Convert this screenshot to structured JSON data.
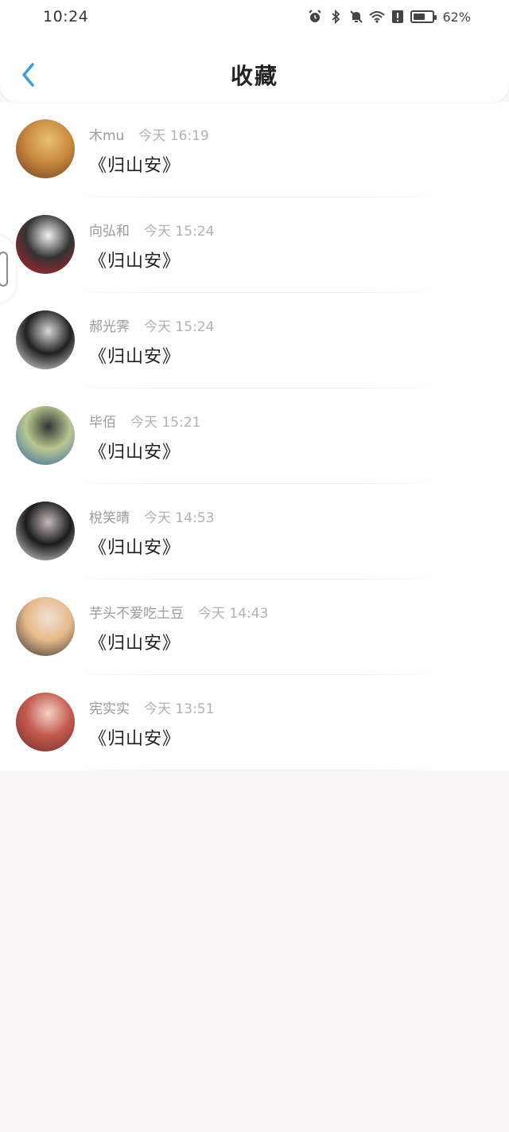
{
  "status_bar": {
    "time": "10:24",
    "battery_percent": "62%",
    "battery_level": 0.62,
    "icons": [
      "alarm-icon",
      "bluetooth-icon",
      "mute-icon",
      "wifi-icon",
      "alert-icon",
      "battery-icon"
    ]
  },
  "header": {
    "title": "收藏",
    "back_icon": "chevron-left-icon",
    "accent": "#3b9be6"
  },
  "favorites": [
    {
      "author": "木mu",
      "time": "今天 16:19",
      "title": "《归山安》",
      "avatar_colors": [
        "#6b3b20",
        "#c98a3f",
        "#e8c070"
      ]
    },
    {
      "author": "向弘和",
      "time": "今天 15:24",
      "title": "《归山安》",
      "avatar_colors": [
        "#c8202a",
        "#333333",
        "#f2f2f2"
      ]
    },
    {
      "author": "郝光霁",
      "time": "今天 15:24",
      "title": "《归山安》",
      "avatar_colors": [
        "#f4f4f4",
        "#202020",
        "#d8d8d8"
      ]
    },
    {
      "author": "毕佰",
      "time": "今天 15:21",
      "title": "《归山安》",
      "avatar_colors": [
        "#2a5fa8",
        "#b8c890",
        "#333333"
      ]
    },
    {
      "author": "梲笑晴",
      "time": "今天 14:53",
      "title": "《归山安》",
      "avatar_colors": [
        "#efe9ea",
        "#1b1b1b",
        "#c5b8ba"
      ]
    },
    {
      "author": "芋头不爱吃土豆",
      "time": "今天 14:43",
      "title": "《归山安》",
      "avatar_colors": [
        "#2e2e2e",
        "#e7b98a",
        "#f1e2d6"
      ]
    },
    {
      "author": "宪实实",
      "time": "今天 13:51",
      "title": "《归山安》",
      "avatar_colors": [
        "#6b2a2a",
        "#c45a4e",
        "#f3d2c8"
      ]
    }
  ]
}
